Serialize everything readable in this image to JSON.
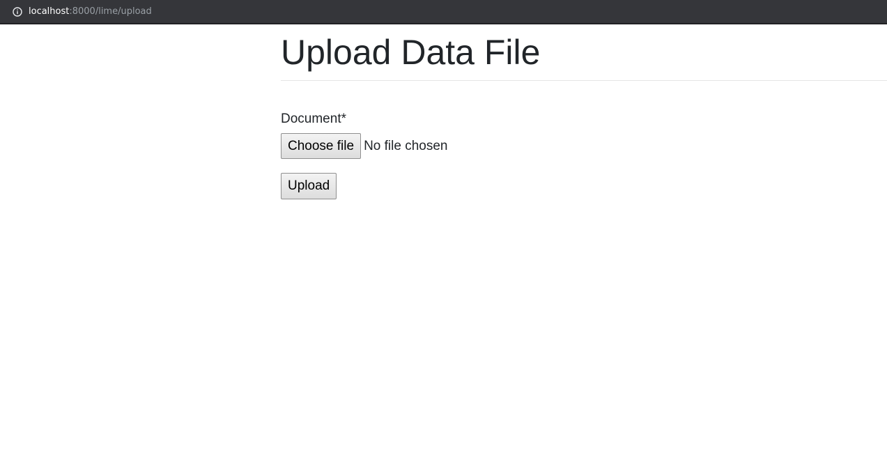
{
  "browser": {
    "url_host": "localhost",
    "url_rest": ":8000/lime/upload",
    "info_icon": "info-icon"
  },
  "page": {
    "title": "Upload Data File"
  },
  "form": {
    "document_label": "Document*",
    "choose_file_label": "Choose file",
    "file_status": "No file chosen",
    "upload_label": "Upload"
  },
  "colors": {
    "url_bar_bg": "#35363a",
    "text": "#212529"
  }
}
